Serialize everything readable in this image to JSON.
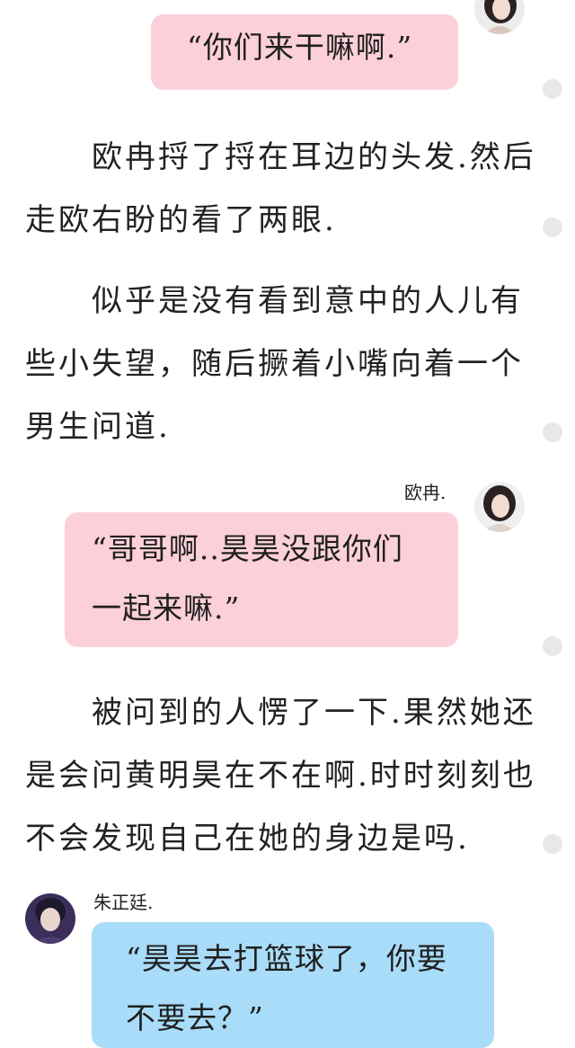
{
  "messages": [
    {
      "speaker": "",
      "lines": [
        "“你们来干嘛啊.”"
      ],
      "color": "#fcd0d9"
    },
    {
      "speaker": "欧冉.",
      "lines": [
        "“哥哥啊..昊昊没跟你们",
        "一起来嘛.”"
      ],
      "color": "#fcd0d9"
    },
    {
      "speaker": "朱正廷.",
      "lines": [
        "“昊昊去打篮球了，你要",
        "不要去？”"
      ],
      "color": "#a9dcf8"
    }
  ],
  "paragraphs": [
    {
      "lines": [
        "　　欧冉捋了捋在耳边的头发.然后",
        "走欧右盼的看了两眼."
      ]
    },
    {
      "lines": [
        "　　似乎是没有看到意中的人儿有",
        "些小失望，随后撅着小嘴向着一个",
        "男生问道."
      ]
    },
    {
      "lines": [
        "　　被问到的人愣了一下.果然她还",
        "是会问黄明昊在不在啊.时时刻刻也",
        "不会发现自己在她的身边是吗."
      ]
    }
  ],
  "avatars": [
    {
      "name": "girl-avatar"
    },
    {
      "name": "girl-avatar"
    },
    {
      "name": "boy-avatar"
    }
  ]
}
